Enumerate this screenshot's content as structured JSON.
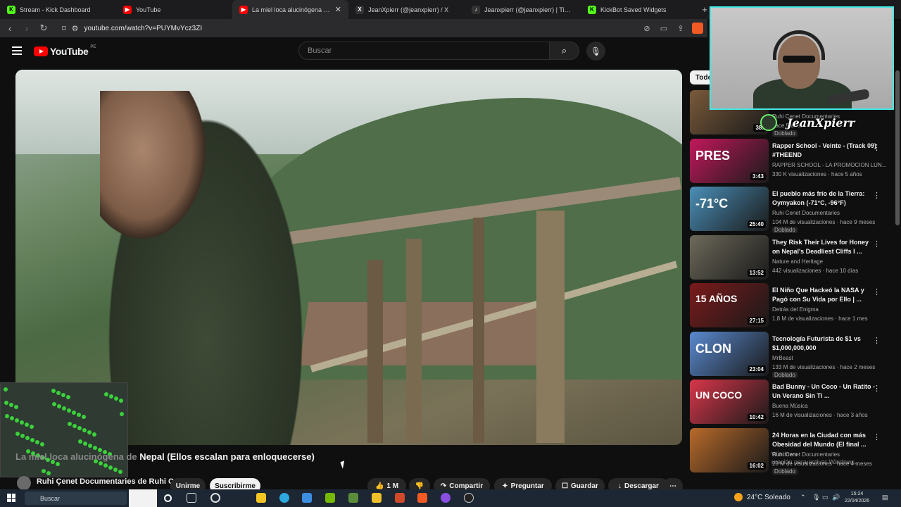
{
  "browser": {
    "tabs": [
      {
        "label": "Stream - Kick Dashboard",
        "icon": "kick-icon",
        "color": "#53fc18"
      },
      {
        "label": "YouTube",
        "icon": "youtube-icon",
        "color": "#ff0000"
      },
      {
        "label": "La miel loca alucinógena de Nepal",
        "icon": "youtube-icon",
        "color": "#ff0000",
        "active": true
      },
      {
        "label": "JeanXpierr (@jeanxpierr) / X",
        "icon": "x-icon",
        "color": "#ffffff"
      },
      {
        "label": "Jeanxpierr (@jeanxpierr) | TikTok",
        "icon": "tiktok-icon",
        "color": "#ffffff"
      },
      {
        "label": "KickBot Saved Widgets",
        "icon": "kickbot-icon",
        "color": "#53fc18"
      }
    ],
    "new_tab": "+",
    "url": "youtube.com/watch?v=PUYMvYcz3ZI"
  },
  "youtube": {
    "logo_text": "YouTube",
    "country_code": "PE",
    "search_placeholder": "Buscar"
  },
  "video": {
    "title_start": "La miel loca alucinógena de",
    "title_end": "Nepal (Ellos escalan para enloquecerse)",
    "channel": "Ruhi Çenet Documentaries de Ruhi Çenet",
    "join_label": "Unirme",
    "subscribe_label": "Suscribirme",
    "likes": "1 M",
    "share_label": "Compartir",
    "ask_label": "Preguntar",
    "save_label": "Guardar",
    "download_label": "Descargar"
  },
  "sidebar": {
    "chip": "Todo",
    "recs": [
      {
        "title": "",
        "channel": "Ruhi Cenet Documentaries",
        "meta": "hace 5 años",
        "badge": "Doblado",
        "duration": "38:",
        "thumb_color": "#7a5a3a"
      },
      {
        "title": "Rapper School - Veinte - (Track 09) #THEEND",
        "channel": "RAPPER SCHOOL - LA PROMOCION LUN...",
        "meta": "330 K visualizaciones · hace 5 años",
        "badge": "",
        "duration": "3:43",
        "thumb_color": "#c2185b",
        "thumb_text": "PRES"
      },
      {
        "title": "El pueblo más frío de la Tierra: Oymyakon (-71°C, -96°F)",
        "channel": "Ruhi Cenet Documentaries",
        "meta": "104 M de visualizaciones · hace 9 meses",
        "badge": "Doblado",
        "duration": "25:40",
        "thumb_color": "#4a8fb8",
        "thumb_text": "-71°C"
      },
      {
        "title": "They Risk Their Lives for Honey on Nepal's Deadliest Cliffs I ...",
        "channel": "Nature and Heritage",
        "meta": "442 visualizaciones · hace 10 días",
        "badge": "",
        "duration": "13:52",
        "thumb_color": "#6d6a5a"
      },
      {
        "title": "El Niño Que Hackeó la NASA y Pagó con Su Vida por Ello | ...",
        "channel": "Detrás del Enigma",
        "meta": "1,8 M de visualizaciones · hace 1 mes",
        "badge": "",
        "duration": "27:15",
        "thumb_color": "#7a1a1a",
        "thumb_text": "15 AÑOS"
      },
      {
        "title": "Tecnología Futurista de $1 vs $1,000,000,000",
        "channel": "MrBeast",
        "meta": "133 M de visualizaciones · hace 2 meses",
        "badge": "Doblado",
        "duration": "23:04",
        "thumb_color": "#5a8ad0",
        "thumb_text": "CLON"
      },
      {
        "title": "Bad Bunny - Un Coco - Un Ratito - Un Verano Sin Ti ...",
        "channel": "Buena Música",
        "meta": "16 M de visualizaciones · hace 3 años",
        "badge": "",
        "duration": "10:42",
        "thumb_color": "#d8364a",
        "thumb_text": "UN COCO"
      },
      {
        "title": "24 Horas en la Ciudad con más Obesidad del Mundo (El final ...",
        "channel": "Ruhi Cenet Documentaries",
        "meta": "28 M de visualizaciones · hace 4 meses",
        "badge": "Doblado",
        "duration": "16:02",
        "thumb_color": "#b86a2a"
      }
    ]
  },
  "overlay": {
    "streamer_name": "JeanXpierr",
    "activate_line1": "Windows",
    "activate_line2": "uración para activar Windows."
  },
  "taskbar": {
    "search_label": "Buscar",
    "weather": "24°C  Soleado",
    "time": "15:24",
    "date": "22/04/2026"
  },
  "colors": {
    "accent_red": "#ff0000",
    "webcam_border": "#45e8e2",
    "kick_green": "#53fc18"
  }
}
